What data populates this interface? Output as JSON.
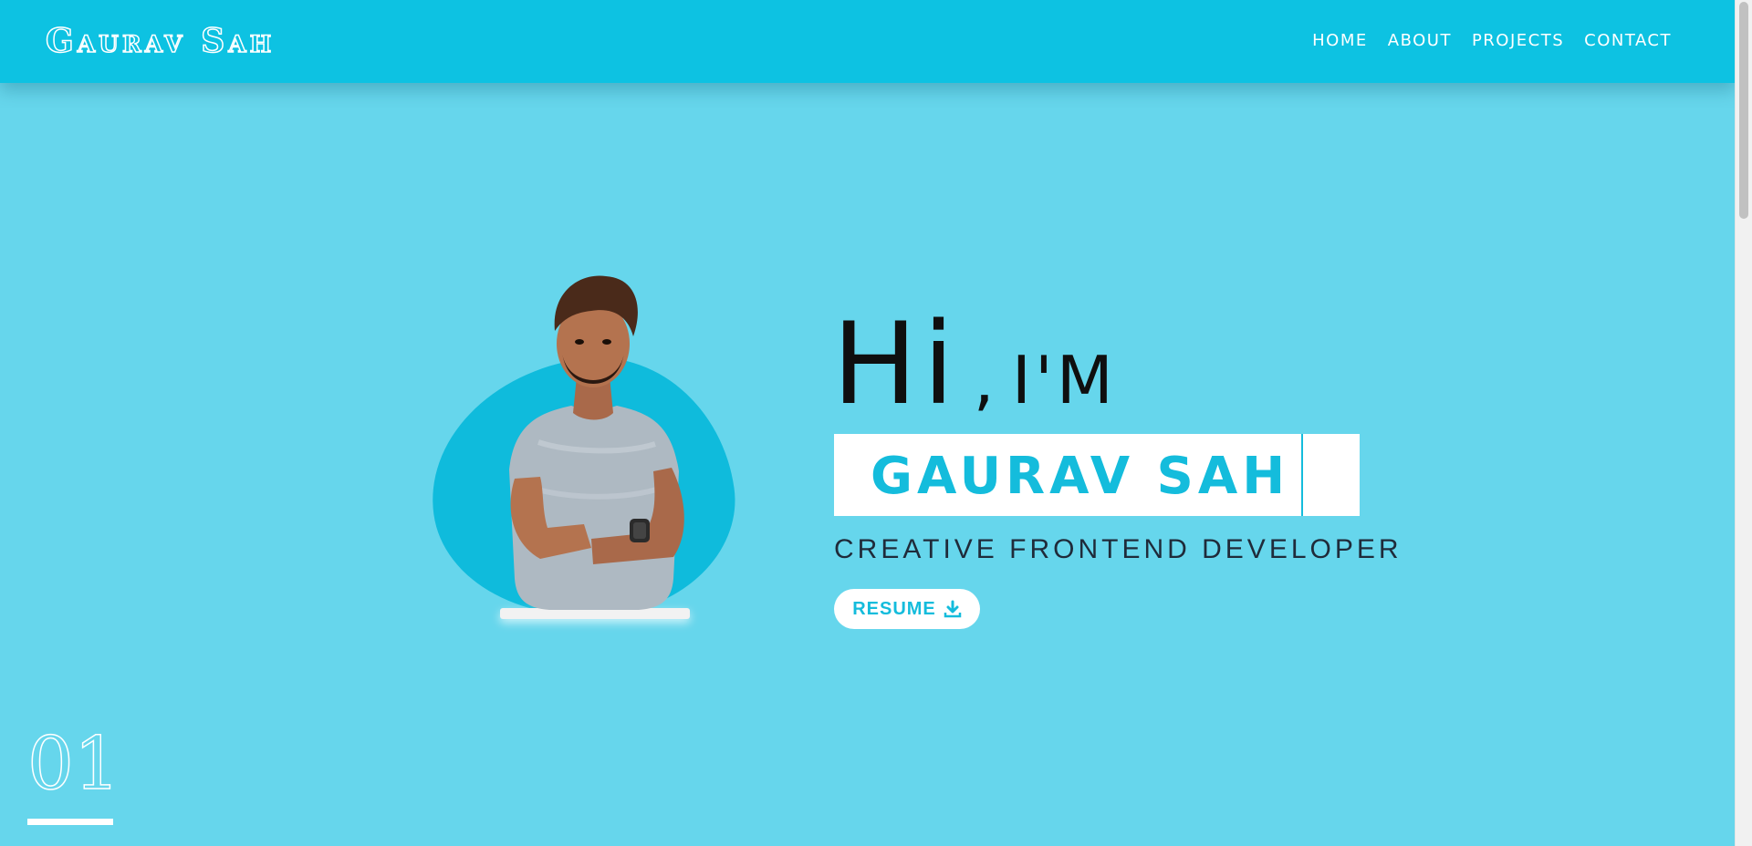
{
  "header": {
    "brand": "Gaurav Sah",
    "nav": [
      {
        "label": "HOME"
      },
      {
        "label": "ABOUT"
      },
      {
        "label": "PROJECTS"
      },
      {
        "label": "CONTACT"
      }
    ]
  },
  "hero": {
    "greeting_hi": "Hi",
    "greeting_comma": ",",
    "greeting_im": "I'M",
    "name": "GAURAV SAH",
    "tagline": "CREATIVE FRONTEND DEVELOPER",
    "resume_label": "RESUME",
    "resume_icon": "download-icon"
  },
  "section": {
    "number": "01"
  },
  "colors": {
    "header_bg": "#0dc2e2",
    "page_bg": "#66d6ec",
    "accent": "#14bcdc",
    "text_dark": "#1f2b3a"
  }
}
